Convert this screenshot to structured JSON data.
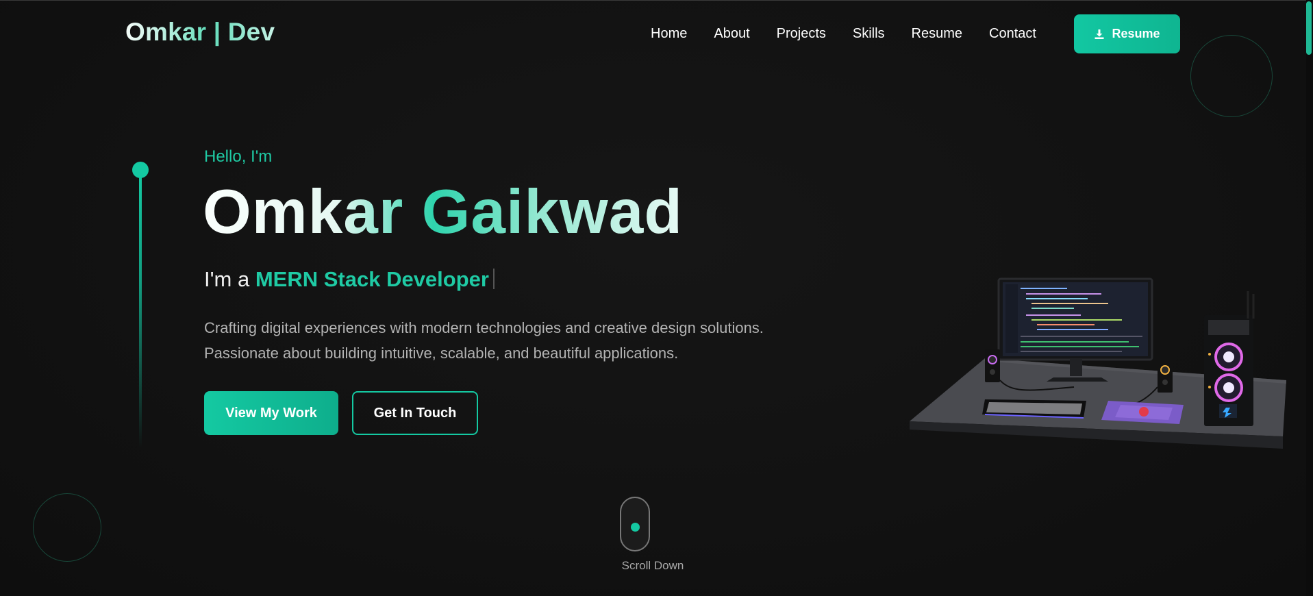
{
  "brand": {
    "logo": "Omkar | Dev"
  },
  "nav": {
    "items": [
      "Home",
      "About",
      "Projects",
      "Skills",
      "Resume",
      "Contact"
    ],
    "resume_button": "Resume",
    "resume_icon": "download-icon"
  },
  "hero": {
    "greeting": "Hello, I'm",
    "first_name": "Omkar",
    "last_name": "Gaikwad",
    "role_prefix": "I'm a",
    "role_highlight": "MERN Stack Developer",
    "description_line1": "Crafting digital experiences with modern technologies and creative design solutions.",
    "description_line2": "Passionate about building intuitive, scalable, and beautiful applications.",
    "primary_cta": "View My Work",
    "secondary_cta": "Get In Touch"
  },
  "scroll": {
    "label": "Scroll Down"
  },
  "colors": {
    "accent": "#14c9a2",
    "background": "#121212",
    "text": "#ffffff",
    "muted": "#b3b3b3"
  }
}
